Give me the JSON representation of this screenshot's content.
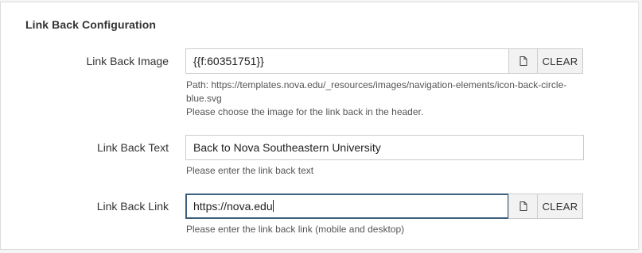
{
  "section": {
    "title": "Link Back Configuration"
  },
  "fields": {
    "image": {
      "label": "Link Back Image",
      "value": "{{f:60351751}}",
      "clear_label": "CLEAR",
      "path_line1": "Path: https://templates.nova.edu/_resources/images/navigation-elements/icon-back-circle-",
      "path_line2": "blue.svg",
      "help": "Please choose the image for the link back in the header."
    },
    "text": {
      "label": "Link Back Text",
      "value": "Back to Nova Southeastern University",
      "help": "Please enter the link back text"
    },
    "link": {
      "label": "Link Back Link",
      "value": "https://nova.edu",
      "clear_label": "CLEAR",
      "help": "Please enter the link back link (mobile and desktop)"
    }
  },
  "icons": {
    "file_browse": "file-icon"
  },
  "colors": {
    "focus_border": "#3b5f7d",
    "input_border": "#cccccc",
    "button_bg": "#f2f2f2"
  }
}
